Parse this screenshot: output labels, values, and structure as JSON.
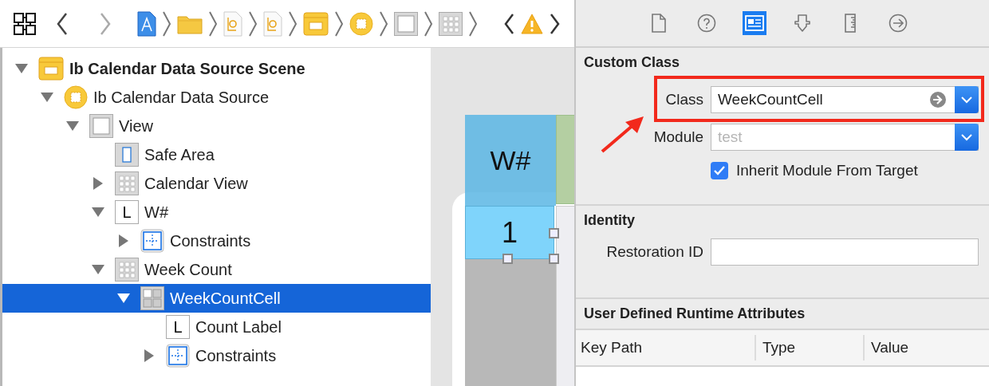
{
  "toolbar": {
    "nav_buttons": [
      {
        "kind": "back",
        "enabled": true
      },
      {
        "kind": "forward",
        "enabled": false
      }
    ],
    "breadcrumbs": [
      {
        "kind": "project"
      },
      {
        "kind": "folder"
      },
      {
        "kind": "file"
      },
      {
        "kind": "file"
      },
      {
        "kind": "scene"
      },
      {
        "kind": "object"
      },
      {
        "kind": "view"
      },
      {
        "kind": "collection"
      }
    ],
    "issue_nav": {
      "kind": "warning"
    }
  },
  "outline": {
    "items": [
      {
        "label": "Ib Calendar Data Source Scene",
        "kind": "scene",
        "expanded": true,
        "selected": false,
        "children": [
          {
            "label": "Ib Calendar Data Source",
            "kind": "object",
            "expanded": true,
            "selected": false,
            "children": [
              {
                "label": "View",
                "kind": "view",
                "expanded": true,
                "selected": false,
                "children": [
                  {
                    "label": "Safe Area",
                    "kind": "safe-area",
                    "selected": false
                  },
                  {
                    "label": "Calendar View",
                    "kind": "collection",
                    "expanded": false,
                    "selected": false
                  },
                  {
                    "label": "W#",
                    "kind": "label",
                    "glyph": "L",
                    "expanded": true,
                    "selected": false,
                    "children": [
                      {
                        "label": "Constraints",
                        "kind": "constraints",
                        "expanded": false,
                        "selected": false
                      }
                    ]
                  },
                  {
                    "label": "Week Count",
                    "kind": "collection",
                    "expanded": true,
                    "selected": false,
                    "children": [
                      {
                        "label": "WeekCountCell",
                        "kind": "cell",
                        "expanded": true,
                        "selected": true,
                        "children": [
                          {
                            "label": "Count Label",
                            "kind": "label",
                            "glyph": "L",
                            "selected": false
                          },
                          {
                            "label": "Constraints",
                            "kind": "constraints",
                            "expanded": false,
                            "selected": false
                          }
                        ]
                      }
                    ]
                  }
                ]
              }
            ]
          }
        ]
      }
    ]
  },
  "canvas": {
    "header_label": "W#",
    "cell_label": "1"
  },
  "inspector": {
    "tabs": [
      {
        "kind": "file",
        "selected": false
      },
      {
        "kind": "help",
        "selected": false
      },
      {
        "kind": "identity",
        "selected": true
      },
      {
        "kind": "attributes",
        "selected": false
      },
      {
        "kind": "size",
        "selected": false
      },
      {
        "kind": "connections",
        "selected": false
      }
    ],
    "custom_class": {
      "title": "Custom Class",
      "class_label": "Class",
      "class_value": "WeekCountCell",
      "module_label": "Module",
      "module_placeholder": "test",
      "inherit_label": "Inherit Module From Target",
      "inherit_checked": true
    },
    "identity": {
      "title": "Identity",
      "restoration_label": "Restoration ID"
    },
    "runtime_attributes": {
      "title": "User Defined Runtime Attributes",
      "columns": [
        "Key Path",
        "Type",
        "Value"
      ]
    }
  }
}
